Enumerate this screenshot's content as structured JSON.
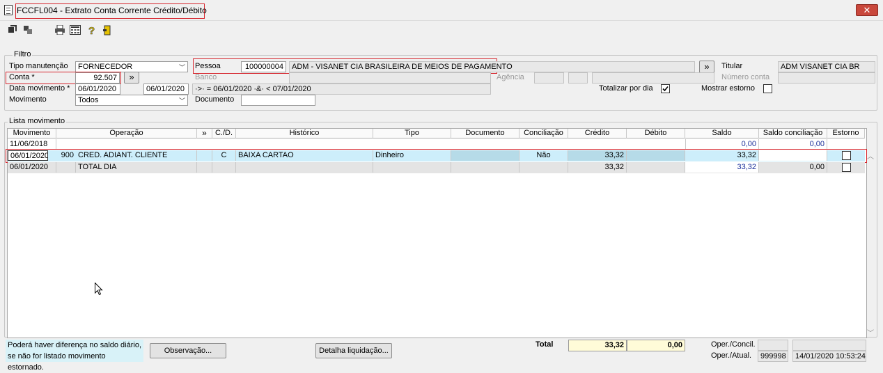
{
  "window": {
    "title": "FCCFL004 - Extrato Conta Corrente Crédito/Débito",
    "close_glyph": "✕"
  },
  "toolbar": {
    "icons": [
      "go-icon",
      "copy-icon",
      "print-icon",
      "calculator-icon",
      "help-icon",
      "exit-icon"
    ]
  },
  "filter": {
    "legend": "Filtro",
    "tipo_manutencao_label": "Tipo manutenção",
    "tipo_manutencao_value": "FORNECEDOR",
    "pessoa_label": "Pessoa",
    "pessoa_code": "100000004",
    "pessoa_name": "ADM - VISANET CIA BRASILEIRA DE MEIOS DE PAGAMENTO",
    "nav_btn": "»",
    "titular_label": "Titular",
    "titular_value": "ADM   VISANET CIA BR",
    "conta_label": "Conta *",
    "conta_value": "92.507",
    "banco_label": "Banco",
    "agencia_label": "Agência",
    "numero_conta_label": "Número conta",
    "data_label": "Data movimento *",
    "data_from": "06/01/2020",
    "data_to": "06/01/2020",
    "data_range": "·>· = 06/01/2020  ·&· < 07/01/2020",
    "totalizar_label": "Totalizar por dia",
    "mostrar_estorno_label": "Mostrar estorno",
    "movimento_label": "Movimento",
    "movimento_value": "Todos",
    "documento_label": "Documento",
    "documento_value": ""
  },
  "list": {
    "legend": "Lista movimento",
    "headers": {
      "movimento": "Movimento",
      "operacao": "Operação",
      "nav": "»",
      "cd": "C./D.",
      "historico": "Histórico",
      "tipo": "Tipo",
      "documento": "Documento",
      "conciliacao": "Conciliação",
      "credito": "Crédito",
      "debito": "Débito",
      "saldo": "Saldo",
      "saldo_conciliacao": "Saldo conciliação",
      "estorno": "Estorno"
    },
    "row0": {
      "movimento": "11/06/2018",
      "saldo": "0,00",
      "saldo_conciliacao": "0,00"
    },
    "row1": {
      "movimento": "06/01/2020",
      "op_code": "900",
      "operacao": "CRED. ADIANT. CLIENTE",
      "cd": "C",
      "historico": "BAIXA CARTAO",
      "tipo": "Dinheiro",
      "documento": "",
      "conciliacao": "Não",
      "credito": "33,32",
      "debito": "",
      "saldo": "33,32",
      "saldo_conciliacao": ""
    },
    "row2": {
      "movimento": "06/01/2020",
      "operacao": "TOTAL DIA",
      "credito": "33,32",
      "saldo": "33,32",
      "saldo_conciliacao": "0,00"
    }
  },
  "footer": {
    "note_line1": "Poderá haver diferença no saldo diário,",
    "note_line2": "se não for listado movimento estornado.",
    "observacao_btn": "Observação...",
    "detalha_btn": "Detalha liquidação...",
    "total_label": "Total",
    "total_credito": "33,32",
    "total_debito": "0,00",
    "oper_concil_label": "Oper./Concil.",
    "oper_concil_user": "",
    "oper_concil_date": "",
    "oper_atual_label": "Oper./Atual.",
    "oper_atual_user": "999998",
    "oper_atual_date": "14/01/2020 10:53:24"
  }
}
